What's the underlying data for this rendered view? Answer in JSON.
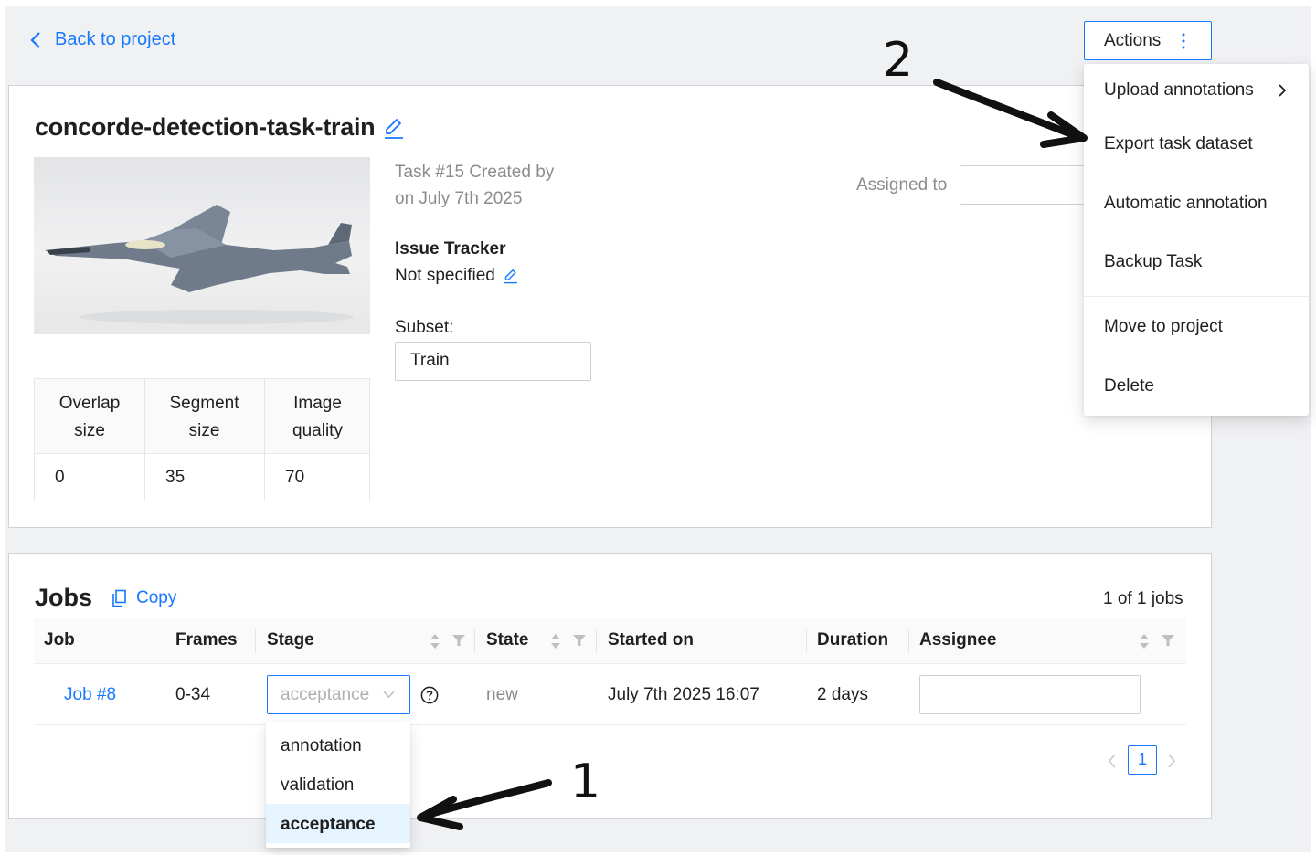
{
  "header": {
    "back_label": "Back to project",
    "actions_label": "Actions"
  },
  "task": {
    "name": "concorde-detection-task-train",
    "created_line1": "Task #15 Created by",
    "created_line2": "on July 7th 2025",
    "issue_tracker_label": "Issue Tracker",
    "issue_tracker_value": "Not specified",
    "subset_label": "Subset:",
    "subset_value": "Train",
    "assigned_label": "Assigned to"
  },
  "params": {
    "headers": [
      {
        "line1": "Overlap",
        "line2": "size"
      },
      {
        "line1": "Segment",
        "line2": "size"
      },
      {
        "line1": "Image",
        "line2": "quality"
      }
    ],
    "values": [
      "0",
      "35",
      "70"
    ]
  },
  "actions_menu": {
    "items": [
      "Upload annotations",
      "Export task dataset",
      "Automatic annotation",
      "Backup Task",
      "Move to project",
      "Delete"
    ]
  },
  "jobs": {
    "title": "Jobs",
    "copy_label": "Copy",
    "count_text": "1 of 1 jobs",
    "columns": [
      "Job",
      "Frames",
      "Stage",
      "State",
      "Started on",
      "Duration",
      "Assignee"
    ],
    "rows": [
      {
        "job": "Job #8",
        "frames": "0-34",
        "stage": "acceptance",
        "state": "new",
        "started_on": "July 7th 2025 16:07",
        "duration": "2 days"
      }
    ],
    "stage_options": [
      "annotation",
      "validation",
      "acceptance"
    ],
    "current_page": "1"
  },
  "annotations": {
    "marker_1": "1",
    "marker_2": "2"
  },
  "colors": {
    "accent": "#1677ff",
    "background": "#f0f1f3",
    "selected_option_bg": "#e6f4ff"
  }
}
